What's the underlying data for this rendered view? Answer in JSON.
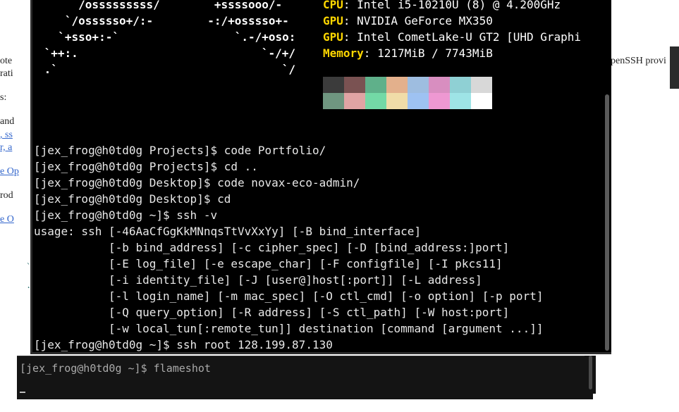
{
  "background_page": {
    "left_fragments": [
      "ote",
      "rati",
      "s:",
      "and",
      ", ss",
      "r, a",
      "e Op",
      "rod",
      "e O"
    ],
    "right_fragment": "penSSH provi"
  },
  "back_terminal": {
    "prompt_line": "[jex_frog@h0td0g ~]$ flameshot",
    "ghost_glyphs": [
      "`",
      "."
    ]
  },
  "neofetch": {
    "ascii_art": [
      "     /osssssssss/        +ssssooo/-",
      "   `/ossssso+/:-        -:/+osssso+-",
      "  `+sso+:-`                 `.-/+oso:",
      " `++:.                           `-/+/",
      " .`                                 `/"
    ],
    "info": [
      {
        "key": "CPU",
        "value": "Intel i5-10210U (8) @ 4.200GHz"
      },
      {
        "key": "GPU",
        "value": "NVIDIA GeForce MX350"
      },
      {
        "key": "GPU",
        "value": "Intel CometLake-U GT2 [UHD Graphi"
      },
      {
        "key": "Memory",
        "value": "1217MiB / 7743MiB"
      }
    ],
    "colors": {
      "row1": [
        "#3b3b3b",
        "#7a5252",
        "#5fb08a",
        "#e3b08c",
        "#9ebde0",
        "#d88ec0",
        "#8fd0d4",
        "#d8d8d8"
      ],
      "row2": [
        "#6f9680",
        "#e0a4a4",
        "#73d9a6",
        "#f0dca8",
        "#9ec2f2",
        "#ee98d2",
        "#9ee4e6",
        "#ffffff"
      ]
    }
  },
  "terminal_lines": [
    "[jex_frog@h0td0g Projects]$ code Portfolio/",
    "[jex_frog@h0td0g Projects]$ cd ..",
    "[jex_frog@h0td0g Desktop]$ code novax-eco-admin/",
    "[jex_frog@h0td0g Desktop]$ cd",
    "[jex_frog@h0td0g ~]$ ssh -v",
    "usage: ssh [-46AaCfGgKkMNnqsTtVvXxYy] [-B bind_interface]",
    "           [-b bind_address] [-c cipher_spec] [-D [bind_address:]port]",
    "           [-E log_file] [-e escape_char] [-F configfile] [-I pkcs11]",
    "           [-i identity_file] [-J [user@]host[:port]] [-L address]",
    "           [-l login_name] [-m mac_spec] [-O ctl_cmd] [-o option] [-p port]",
    "           [-Q query_option] [-R address] [-S ctl_path] [-W host:port]",
    "           [-w local_tun[:remote_tun]] destination [command [argument ...]]",
    "[jex_frog@h0td0g ~]$ ssh root 128.199.87.130"
  ]
}
